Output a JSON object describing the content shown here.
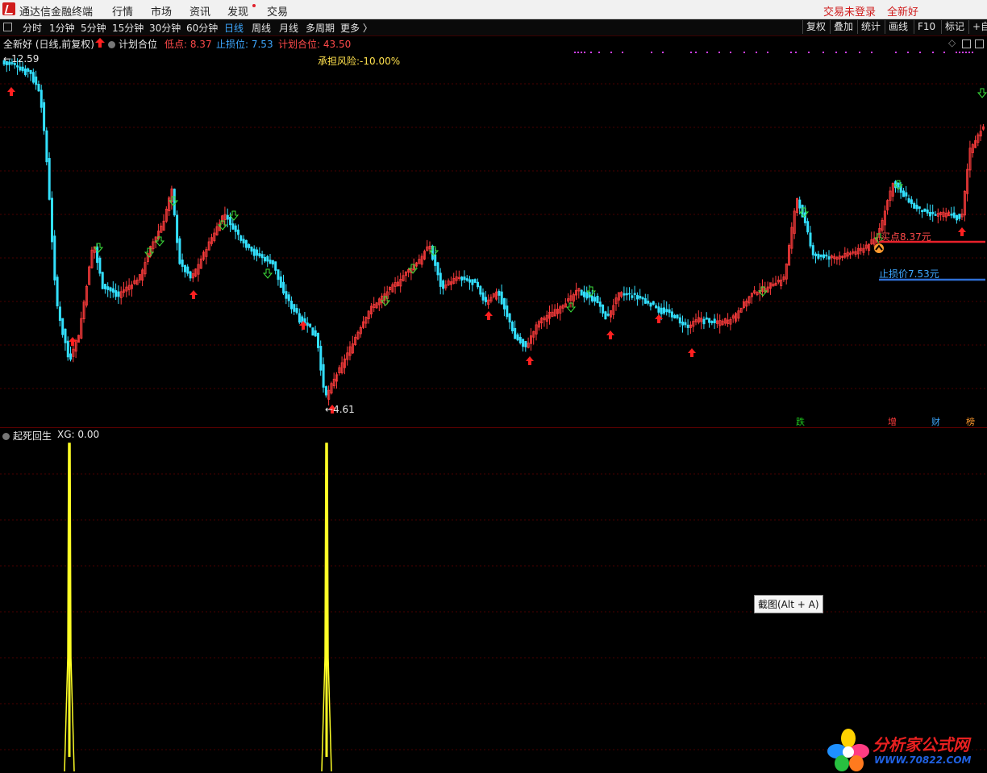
{
  "menubar": {
    "app_title": "通达信金融终端",
    "items": [
      "行情",
      "市场",
      "资讯",
      "发现",
      "交易"
    ],
    "login_status": "交易未登录",
    "stock_name": "全新好"
  },
  "toolbar": {
    "periods": [
      "分时",
      "1分钟",
      "5分钟",
      "15分钟",
      "30分钟",
      "60分钟",
      "日线",
      "周线",
      "月线",
      "多周期",
      "更多 〉"
    ],
    "active_period": "日线",
    "right_buttons": [
      "复权",
      "叠加",
      "统计",
      "画线",
      "F10",
      "标记",
      "+自"
    ]
  },
  "main_info": {
    "title": "全新好 (日线,前复权)",
    "indicator": "计划合位",
    "low_label": "低点: 8.37",
    "stop_label": "止损位: 7.53",
    "plan_label": "计划合位: 43.50",
    "risk_text": "承担风险:-10.00%",
    "high_price": "12.59",
    "low_price": "4.61",
    "buy_point": "买点8.37元",
    "stop_price": "止损价7.53元"
  },
  "event_tags": [
    {
      "text": "跌",
      "color": "#1ec81e"
    },
    {
      "text": "增",
      "color": "#ff3b3b"
    },
    {
      "text": "财",
      "color": "#3ea8ff"
    },
    {
      "text": "榜",
      "color": "#ff9a2e"
    }
  ],
  "indicator_panel": {
    "name": "起死回生",
    "value_label": "XG: 0.00"
  },
  "tooltip": "截图(Alt + A)",
  "watermark": {
    "title": "分析家公式网",
    "url": "WWW.70822.COM"
  },
  "colors": {
    "up": "#ff3c3c",
    "down": "#33e0ff",
    "signal": "#ffff26",
    "buy_line": "#e8202a",
    "stop_line": "#2f6fd6"
  },
  "icons": {
    "up_signal": "red-up-arrow-icon",
    "down_signal": "green-down-arrow-icon"
  }
}
